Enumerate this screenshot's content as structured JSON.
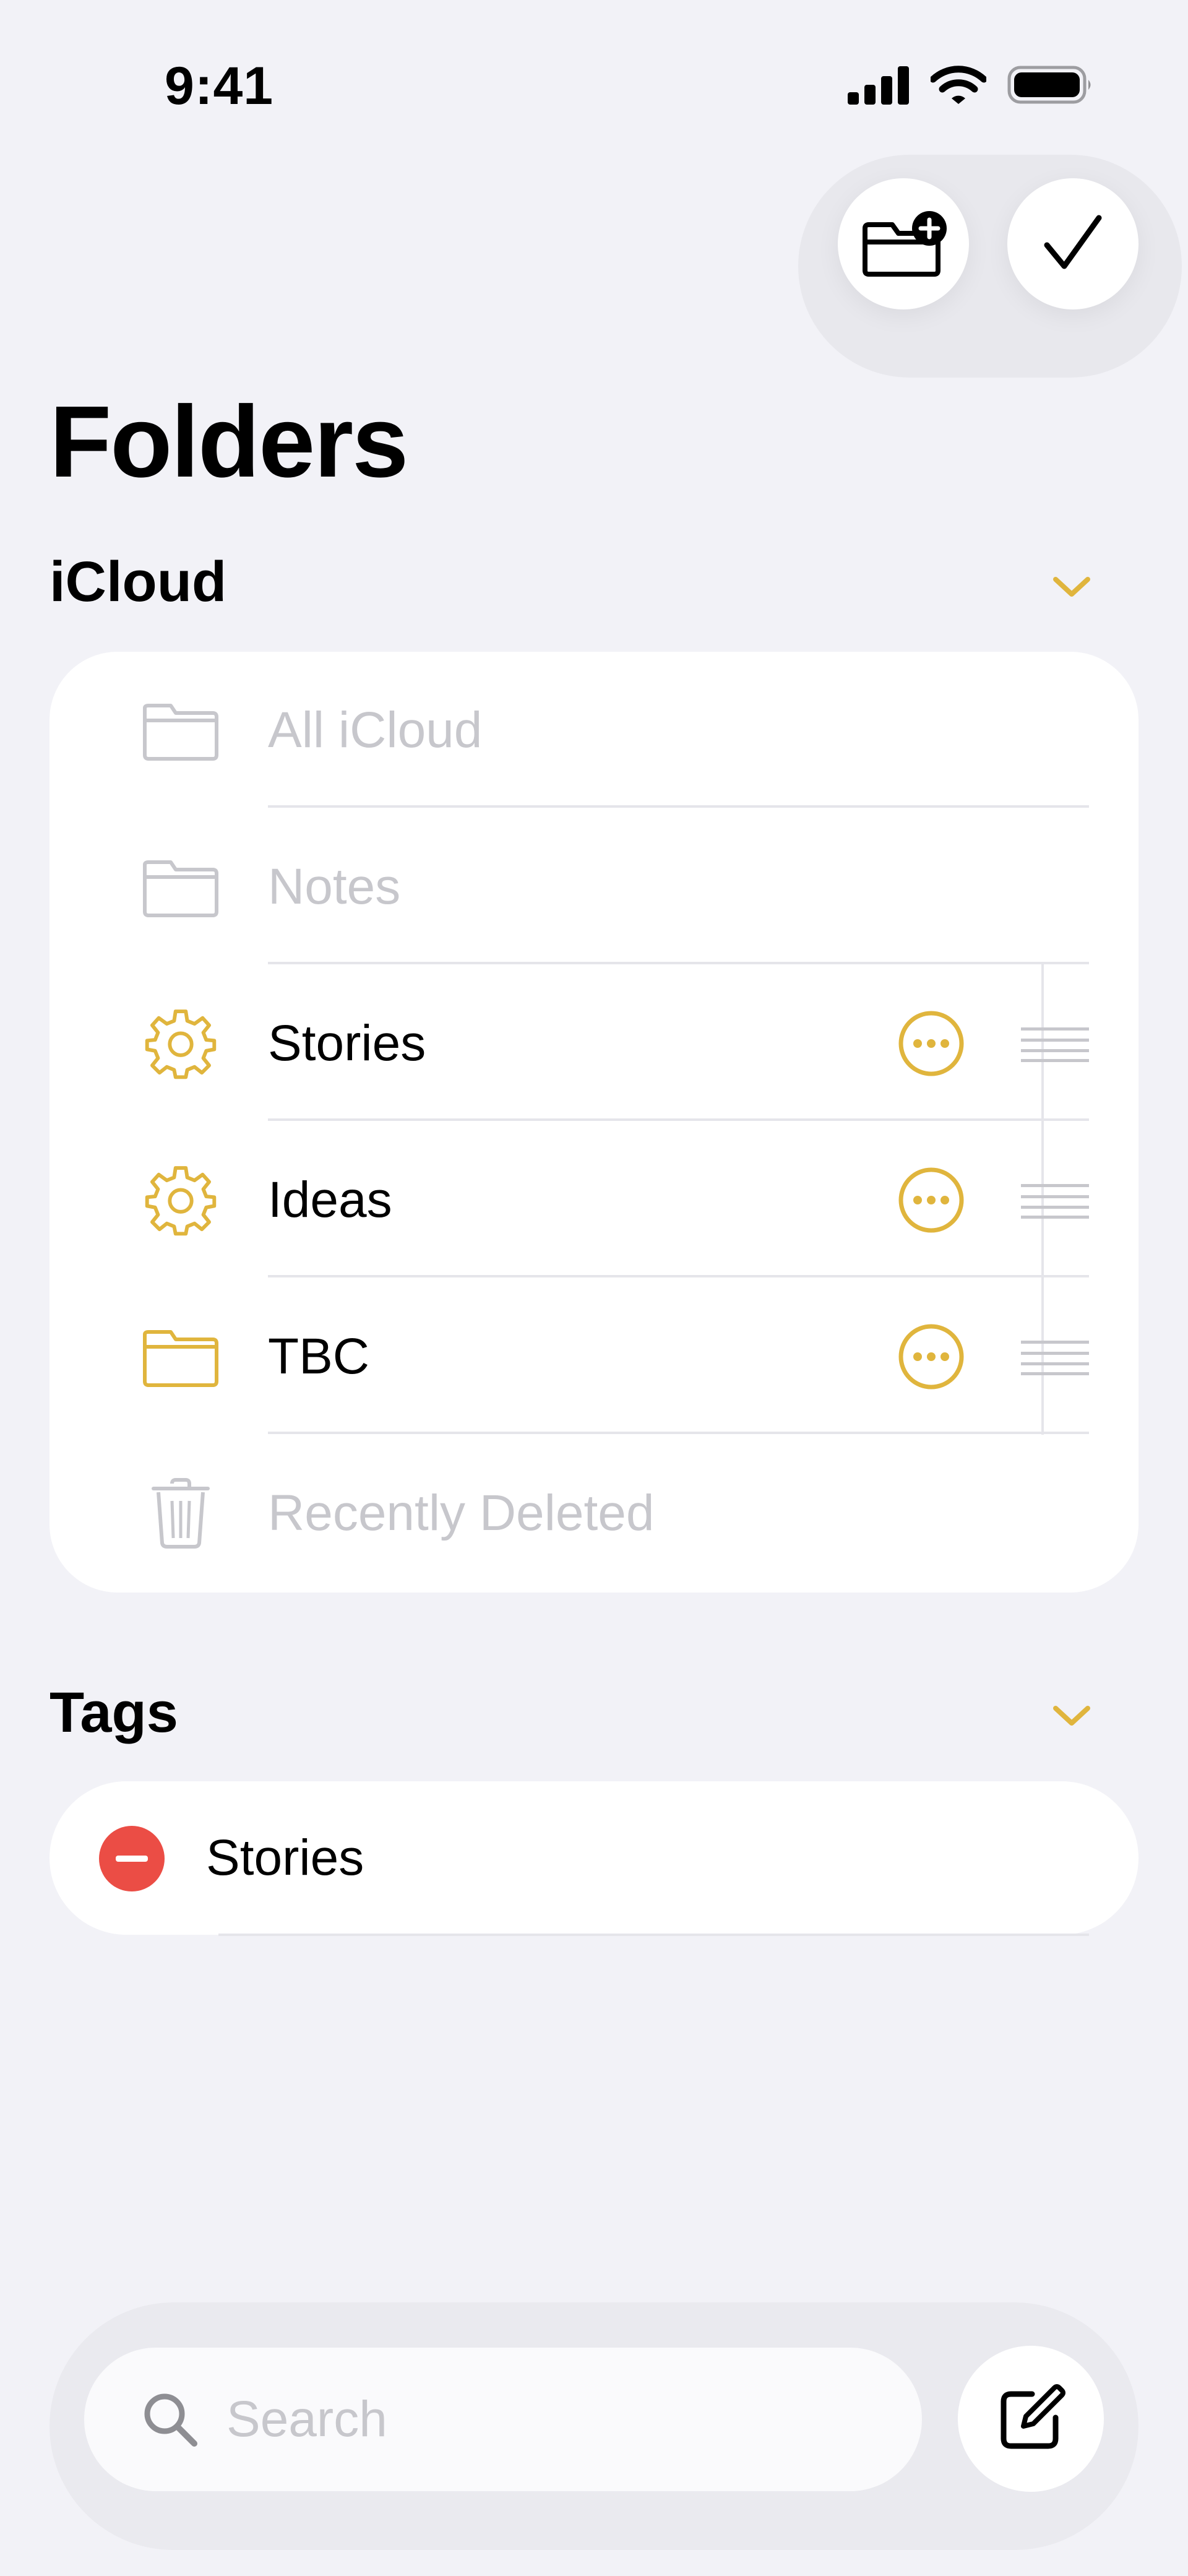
{
  "status_bar": {
    "time": "9:41"
  },
  "page": {
    "title": "Folders"
  },
  "icloud_section": {
    "title": "iCloud",
    "items": [
      {
        "label": "All iCloud",
        "icon": "folder-icon",
        "state": "dim"
      },
      {
        "label": "Notes",
        "icon": "folder-icon",
        "state": "dim"
      },
      {
        "label": "Stories",
        "icon": "gear-icon",
        "state": "editable"
      },
      {
        "label": "Ideas",
        "icon": "gear-icon",
        "state": "editable"
      },
      {
        "label": "TBC",
        "icon": "folder-icon",
        "state": "editable"
      },
      {
        "label": "Recently Deleted",
        "icon": "trash-icon",
        "state": "dim"
      }
    ]
  },
  "tags_section": {
    "title": "Tags",
    "items": [
      {
        "label": "Stories",
        "icon": "minus-circle-icon"
      }
    ]
  },
  "search": {
    "placeholder": "Search"
  },
  "colors": {
    "accent": "#E0B53D",
    "delete": "#EB4D45",
    "dim": "#C7C7CC",
    "background": "#F2F2F7"
  }
}
